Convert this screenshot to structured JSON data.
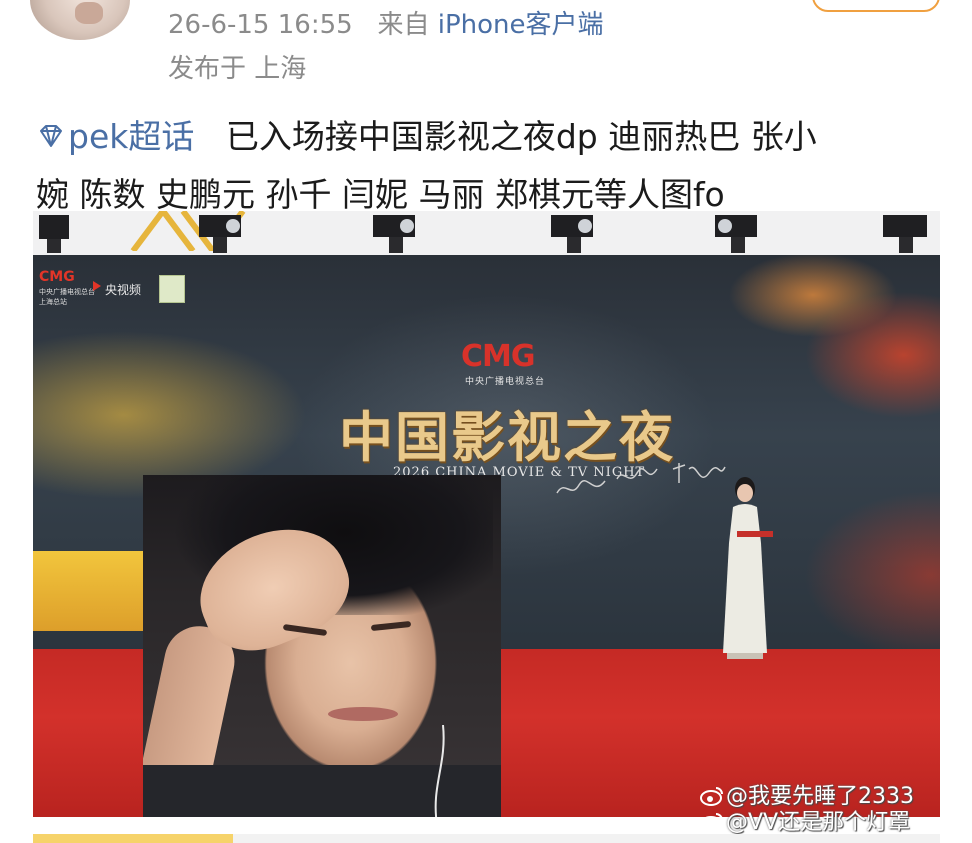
{
  "post": {
    "meta": {
      "time": "26-6-15 16:55",
      "source_prefix": "来自",
      "source": "iPhone客户端",
      "location": "发布于 上海"
    },
    "topic": "pek超话",
    "text_line1": "已入场接中国影视之夜dp 迪丽热巴 张小",
    "text_line2": "婉 陈数 史鹏元 孙千 闫妮 马丽 郑棋元等人图fo"
  },
  "image": {
    "cmg_logo": "CMG",
    "cmg_logo_sub": "中央广播电视总台",
    "cmg_small_sub": "上海总站",
    "cctv_video": "央视频",
    "event_title": "中国影视之夜",
    "event_subtitle": "2026 CHINA MOVIE & TV NIGHT"
  },
  "watermark": {
    "line1": "@我要先睡了2333",
    "line2": "@VV还是那个灯罩"
  },
  "colors": {
    "link": "#4a6fa5",
    "meta": "#8b8b8b",
    "carpet": "#c52a25",
    "follow_border": "#f0a040"
  },
  "icons": {
    "topic": "diamond-icon",
    "watermark": "weibo-icon"
  }
}
